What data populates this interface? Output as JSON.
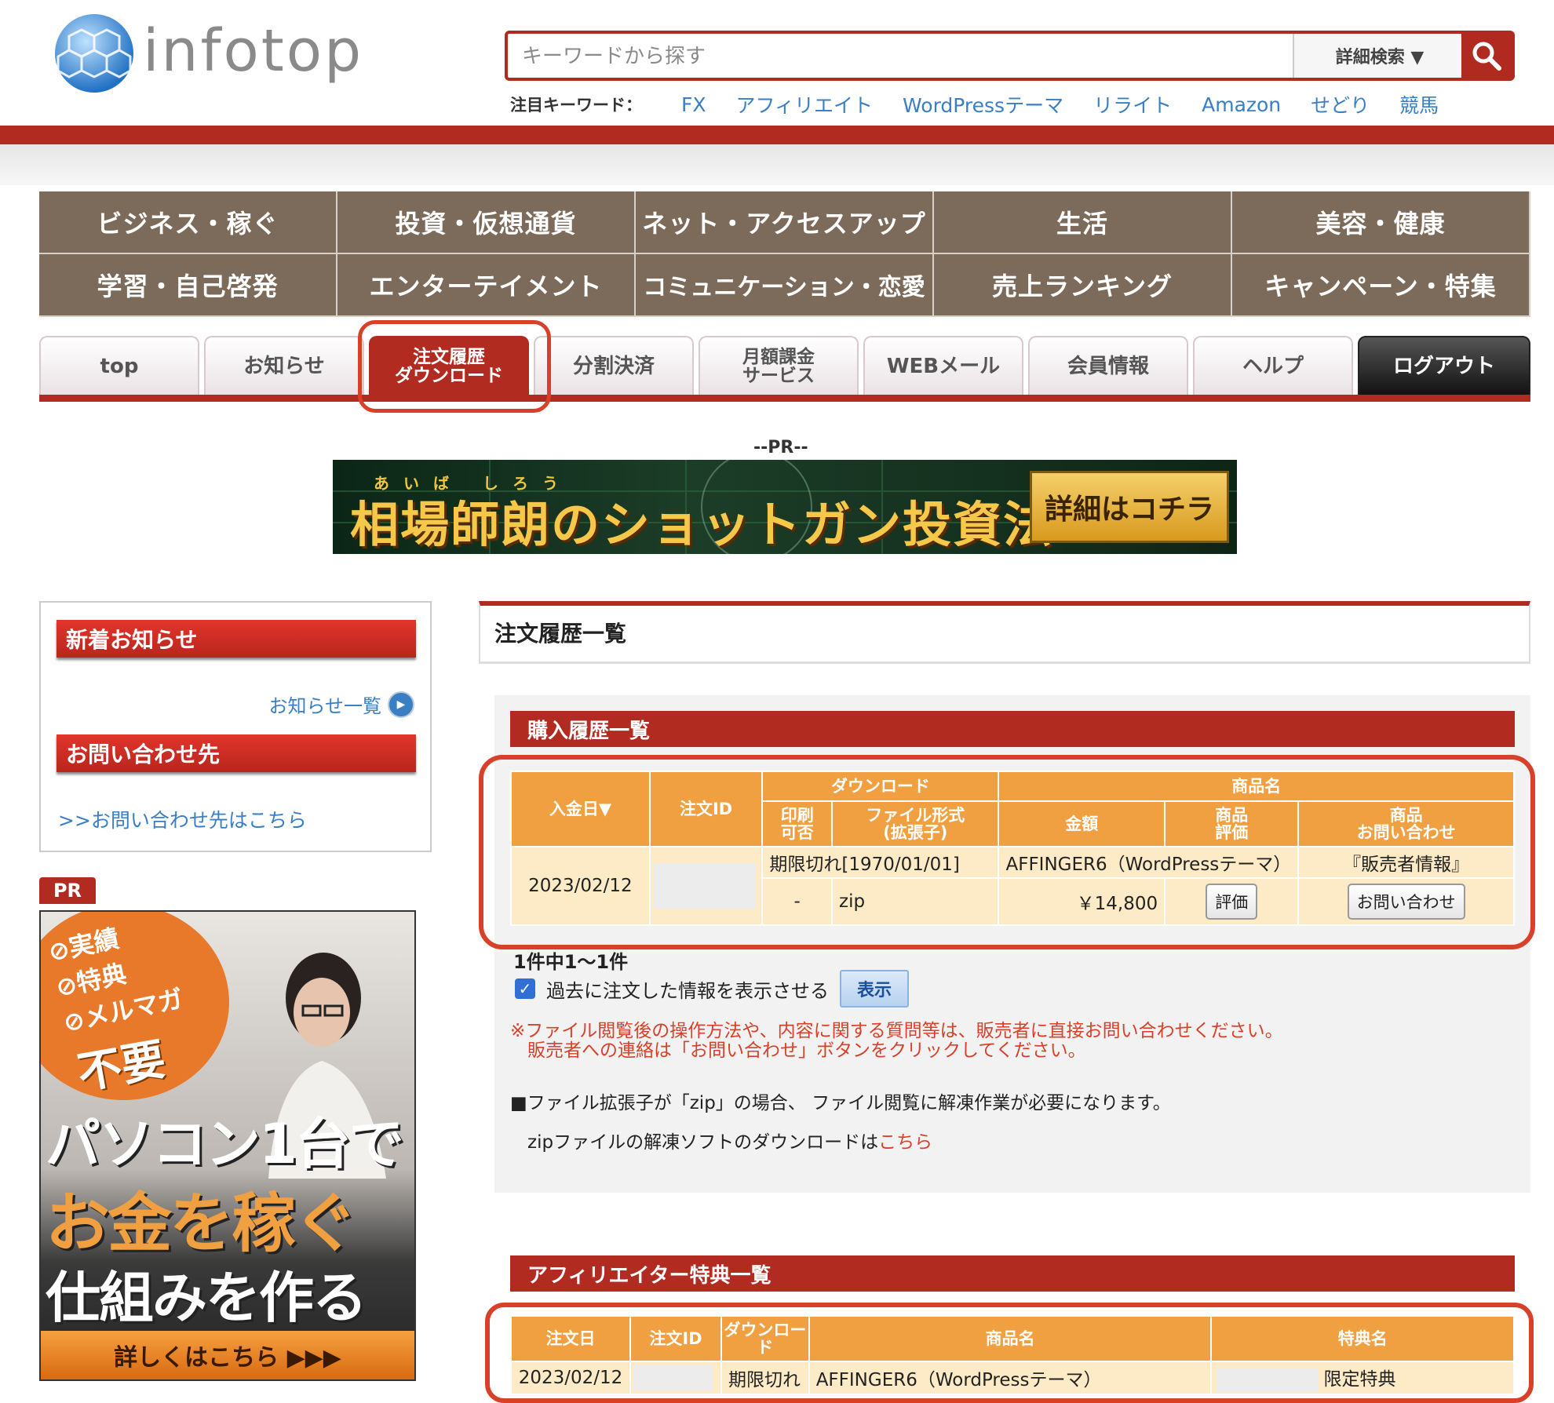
{
  "header": {
    "logo_text": "infotop",
    "search_placeholder": "キーワードから探す",
    "detail_search": "詳細検索 ▼",
    "keywords_label": "注目キーワード：",
    "keywords": [
      "FX",
      "アフィリエイト",
      "WordPressテーマ",
      "リライト",
      "Amazon",
      "せどり",
      "競馬"
    ]
  },
  "categories": [
    "ビジネス・稼ぐ",
    "投資・仮想通貨",
    "ネット・アクセスアップ",
    "生活",
    "美容・健康",
    "学習・自己啓発",
    "エンターテイメント",
    "コミュニケーション・恋愛",
    "売上ランキング",
    "キャンペーン・特集"
  ],
  "tabs": [
    {
      "label": "top"
    },
    {
      "label": "お知らせ"
    },
    {
      "label": "注文履歴\nダウンロード"
    },
    {
      "label": "分割決済"
    },
    {
      "label": "月額課金\nサービス"
    },
    {
      "label": "WEBメール"
    },
    {
      "label": "会員情報"
    },
    {
      "label": "ヘルプ"
    },
    {
      "label": "ログアウト"
    }
  ],
  "active_tab": "注文履歴ダウンロード",
  "pr": {
    "label": "--PR--",
    "banner_furigana": "あいば しろう",
    "banner_title": "相場師朗のショットガン投資法",
    "banner_button": "詳細はコチラ"
  },
  "sidebar": {
    "news_heading": "新着お知らせ",
    "news_list_link": "お知らせ一覧",
    "contact_heading": "お問い合わせ先",
    "contact_link": ">>お問い合わせ先はこちら",
    "pr_tag": "PR",
    "ad": {
      "bubble_lines": [
        "⊘実績",
        "⊘特典",
        "⊘メルマガ"
      ],
      "bubble_bottom": "不要",
      "line1": "パソコン1台で",
      "line2": "お金を稼ぐ",
      "line3": "仕組みを作る",
      "cta": "詳しくはこちら ▶▶▶"
    }
  },
  "main": {
    "title": "注文履歴一覧",
    "purchase": {
      "heading": "購入履歴一覧",
      "headers": {
        "date": "入金日▼",
        "order_id": "注文ID",
        "download": "ダウンロード",
        "product": "商品名",
        "print": "印刷\n可否",
        "file_format": "ファイル形式\n(拡張子)",
        "amount": "金額",
        "review": "商品\n評価",
        "inquiry": "商品\nお問い合わせ"
      },
      "row": {
        "date": "2023/02/12",
        "expiry": "期限切れ[1970/01/01]",
        "product_name": "AFFINGER6（WordPressテーマ）",
        "seller_info": "『販売者情報』",
        "print": "-",
        "format": "zip",
        "amount": "￥14,800",
        "review_button": "評価",
        "inquiry_button": "お問い合わせ"
      },
      "count": "1件中1〜1件",
      "past_label": "過去に注文した情報を表示させる",
      "show_button": "表示",
      "notice_red_1": "※ファイル閲覧後の操作方法や、内容に関する質問等は、販売者に直接お問い合わせください。",
      "notice_red_2": "販売者への連絡は「お問い合わせ」ボタンをクリックしてください。",
      "notice_zip": "■ファイル拡張子が「zip」の場合、 ファイル閲覧に解凍作業が必要になります。",
      "notice_download": "zipファイルの解凍ソフトのダウンロードは",
      "notice_link": "こちら"
    },
    "affiliate": {
      "heading": "アフィリエイター特典一覧",
      "headers": [
        "注文日",
        "注文ID",
        "ダウンロード",
        "商品名",
        "特典名"
      ],
      "row": {
        "date": "2023/02/12",
        "download": "期限切れ",
        "product_name": "AFFINGER6（WordPressテーマ）",
        "bonus": "限定特典"
      }
    }
  },
  "colors": {
    "brand_red": "#b22b21",
    "category_brown": "#7c6b5a",
    "table_header_orange": "#f0a040",
    "table_cell_cream": "#fcebc6",
    "link_blue": "#3a7fc4",
    "highlight_red": "#d9402a"
  }
}
